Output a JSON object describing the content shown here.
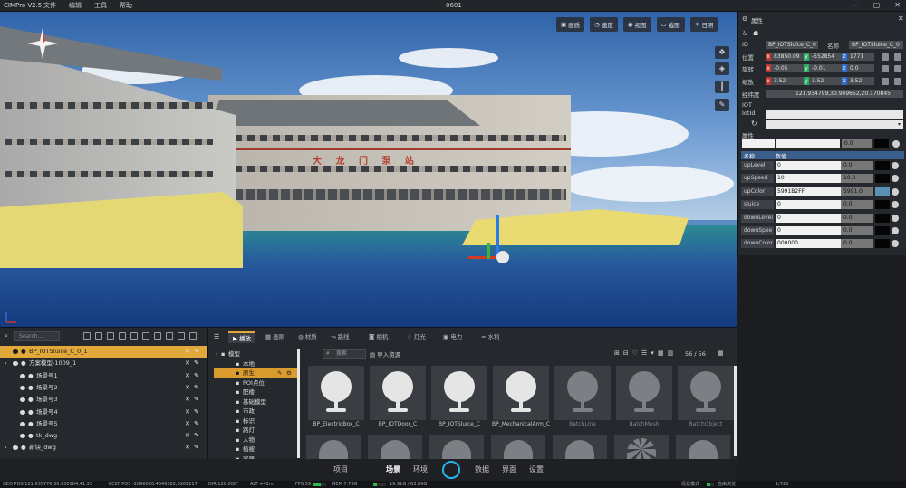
{
  "titlebar": {
    "app": "CIMPro V2.5",
    "menus": [
      "文件",
      "编辑",
      "工具",
      "帮助"
    ],
    "document": "0601",
    "window_buttons": [
      "—",
      "▢",
      "✕"
    ]
  },
  "viewport": {
    "toolbar": [
      "画质",
      "速度",
      "视图",
      "截图",
      "日照"
    ],
    "building_sign": "大 龙 门 泵 站"
  },
  "props": {
    "title": "属性",
    "object_name": "BP_IOTSluice_C_0_1",
    "id_label": "ID",
    "id_value": "BP_IOTSluice_C_0",
    "name_label": "名称",
    "name_value": "BP_IOTSluice_C_0",
    "position": {
      "label": "位置",
      "x": "83850.09",
      "y": "-552854",
      "z": "1771"
    },
    "rotation": {
      "label": "旋转",
      "x": "-0.05",
      "y": "-0.01",
      "z": "0.0"
    },
    "scale": {
      "label": "缩放",
      "x": "3.52",
      "y": "3.52",
      "z": "3.52"
    },
    "lonlat_label": "经纬度",
    "lonlat_value": "121.934799,30.949652,20.170845",
    "iot_label": "IOT",
    "iotid_label": "IotId",
    "attr_label": "属性",
    "attr_num": "0.0",
    "table_headers": [
      "名称",
      "数值"
    ],
    "rows": [
      {
        "name": "upLevel",
        "value": "0",
        "num": "0.0",
        "swatch": "#050505"
      },
      {
        "name": "upSpeed",
        "value": "10",
        "num": "10.0",
        "swatch": "#050505"
      },
      {
        "name": "upColor",
        "value": "5991B2FF",
        "num": "5991.0",
        "swatch": "#5991b2"
      },
      {
        "name": "sluice",
        "value": "0",
        "num": "0.0",
        "swatch": "#050505"
      },
      {
        "name": "downLevel",
        "value": "0",
        "num": "0.0",
        "swatch": "#050505"
      },
      {
        "name": "downSpee",
        "value": "0",
        "num": "0.0",
        "swatch": "#050505"
      },
      {
        "name": "downColor",
        "value": "000000",
        "num": "0.0",
        "swatch": "#050505"
      }
    ]
  },
  "tree": {
    "search_placeholder": "Search...",
    "items": [
      {
        "label": "BP_IOTSluice_C_0_1",
        "selected": true
      },
      {
        "label": "方案模型-1009_1"
      },
      {
        "label": "场景号1"
      },
      {
        "label": "场景号2"
      },
      {
        "label": "场景号3"
      },
      {
        "label": "场景号4"
      },
      {
        "label": "场景号5"
      },
      {
        "label": "tk_dwg"
      },
      {
        "label": "新块_dwg"
      }
    ]
  },
  "resources": {
    "tabs": [
      "播放",
      "画刷",
      "材质",
      "路线",
      "相机",
      "灯光",
      "电力",
      "水利"
    ],
    "search_placeholder": "搜索",
    "import_label": "导入资源",
    "page": "56 / 56",
    "categories": [
      "模型",
      "本地",
      "原生",
      "POI点位",
      "配楼",
      "基础模型",
      "市政",
      "标识",
      "路灯",
      "人物",
      "植被",
      "家居"
    ],
    "assets": [
      {
        "label": "BP_ElectricBox_C",
        "style": "bright"
      },
      {
        "label": "BP_IOTDoor_C",
        "style": "bright"
      },
      {
        "label": "BP_IOTSluice_C",
        "style": "bright"
      },
      {
        "label": "BP_MechanicalArm_C",
        "style": "bright"
      },
      {
        "label": "BatchLine",
        "style": "dim"
      },
      {
        "label": "BatchMesh",
        "style": "dim"
      },
      {
        "label": "BatchObject",
        "style": "dim"
      }
    ]
  },
  "nav": {
    "items": [
      "项目",
      "场景",
      "环境",
      "数据",
      "界面",
      "设置"
    ],
    "active": "场景"
  },
  "status": {
    "geo": "GEO POS   121.935776,30.950584,41.33",
    "ecef": "ECEF POS   -2896020.4646182,3261217",
    "dir": "DIR   126.008°",
    "alt": "ALT   +42m",
    "fps": "FPS   59",
    "mem": "MEM   7.73G",
    "mem2": "19.91G / 63.89G",
    "mode": "场景模式",
    "auto": "自由浏览",
    "count": "1/725",
    "progress": {
      "fps": 0.6,
      "mem": 0.3,
      "right": 0.5
    }
  },
  "colors": {
    "accent": "#e2a83a",
    "cyan": "#27b6e8",
    "panel": "#25282d"
  }
}
